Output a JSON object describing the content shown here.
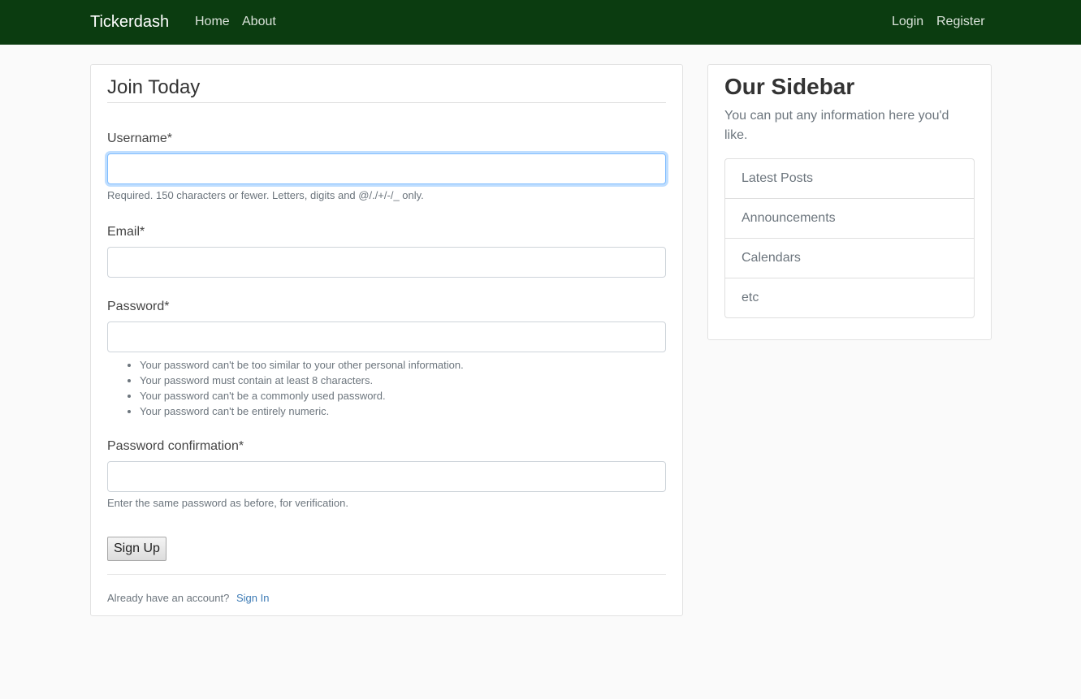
{
  "navbar": {
    "brand": "Tickerdash",
    "links": [
      "Home",
      "About"
    ],
    "auth_links": [
      "Login",
      "Register"
    ]
  },
  "form": {
    "legend": "Join Today",
    "username": {
      "label": "Username*",
      "value": "",
      "help": "Required. 150 characters or fewer. Letters, digits and @/./+/-/_ only."
    },
    "email": {
      "label": "Email*",
      "value": ""
    },
    "password": {
      "label": "Password*",
      "value": "",
      "help_items": [
        "Your password can't be too similar to your other personal information.",
        "Your password must contain at least 8 characters.",
        "Your password can't be a commonly used password.",
        "Your password can't be entirely numeric."
      ]
    },
    "password_confirmation": {
      "label": "Password confirmation*",
      "value": "",
      "help": "Enter the same password as before, for verification."
    },
    "submit_label": "Sign Up",
    "footer_text": "Already have an account?",
    "footer_link": "Sign In"
  },
  "sidebar": {
    "title": "Our Sidebar",
    "text": "You can put any information here you'd like.",
    "items": [
      "Latest Posts",
      "Announcements",
      "Calendars",
      "etc"
    ]
  }
}
